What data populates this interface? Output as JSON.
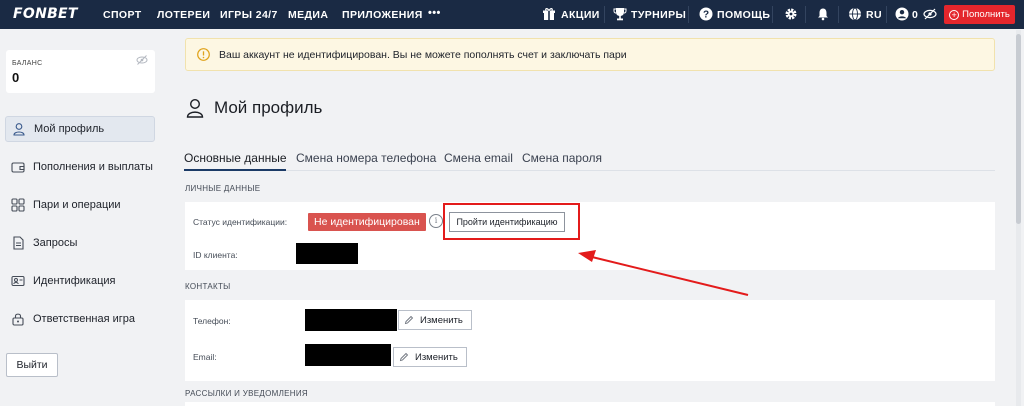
{
  "nav": {
    "logo": "FONBET",
    "items": [
      "СПОРТ",
      "ЛОТЕРЕИ",
      "ИГРЫ 24/7",
      "МЕДИА",
      "ПРИЛОЖЕНИЯ"
    ],
    "more": "•••",
    "promo": "АКЦИИ",
    "tournaments": "ТУРНИРЫ",
    "help": "ПОМОЩЬ",
    "lang": "RU",
    "user_balance": "0",
    "topup": "Пополнить",
    "icons": [
      "gift-icon",
      "trophy-icon",
      "help-icon",
      "gear-icon",
      "bell-icon",
      "globe-icon",
      "user-icon",
      "eye-off-icon",
      "plus-icon"
    ],
    "bg_color": "#1a2a44",
    "accent": "#e4262c"
  },
  "sidebar": {
    "balance_label": "БАЛАНС",
    "balance_value": "0",
    "items": [
      {
        "label": "Мой профиль",
        "icon": "user-icon",
        "active": true
      },
      {
        "label": "Пополнения и выплаты",
        "icon": "wallet-icon",
        "active": false
      },
      {
        "label": "Пари и операции",
        "icon": "grid-icon",
        "active": false
      },
      {
        "label": "Запросы",
        "icon": "document-icon",
        "active": false
      },
      {
        "label": "Идентификация",
        "icon": "id-card-icon",
        "active": false
      },
      {
        "label": "Ответственная игра",
        "icon": "lock-icon",
        "active": false
      }
    ],
    "logout": "Выйти"
  },
  "alert": {
    "text": "Ваш аккаунт не идентифицирован. Вы не можете пополнять счет и заключать пари",
    "icon": "warning-icon"
  },
  "profile": {
    "title": "Мой профиль",
    "tabs": [
      "Основные данные",
      "Смена номера телефона",
      "Смена email",
      "Смена пароля"
    ],
    "sections": {
      "personal": "ЛИЧНЫЕ ДАННЫЕ",
      "contacts": "КОНТАКТЫ",
      "mailings": "РАССЫЛКИ И УВЕДОМЛЕНИЯ"
    },
    "id_status_label": "Статус идентификации:",
    "id_status_value": "Не идентифицирован",
    "verify_button": "Пройти идентификацию",
    "client_id_label": "ID клиента:",
    "phone_label": "Телефон:",
    "email_label": "Email:",
    "edit_label": "Изменить"
  }
}
